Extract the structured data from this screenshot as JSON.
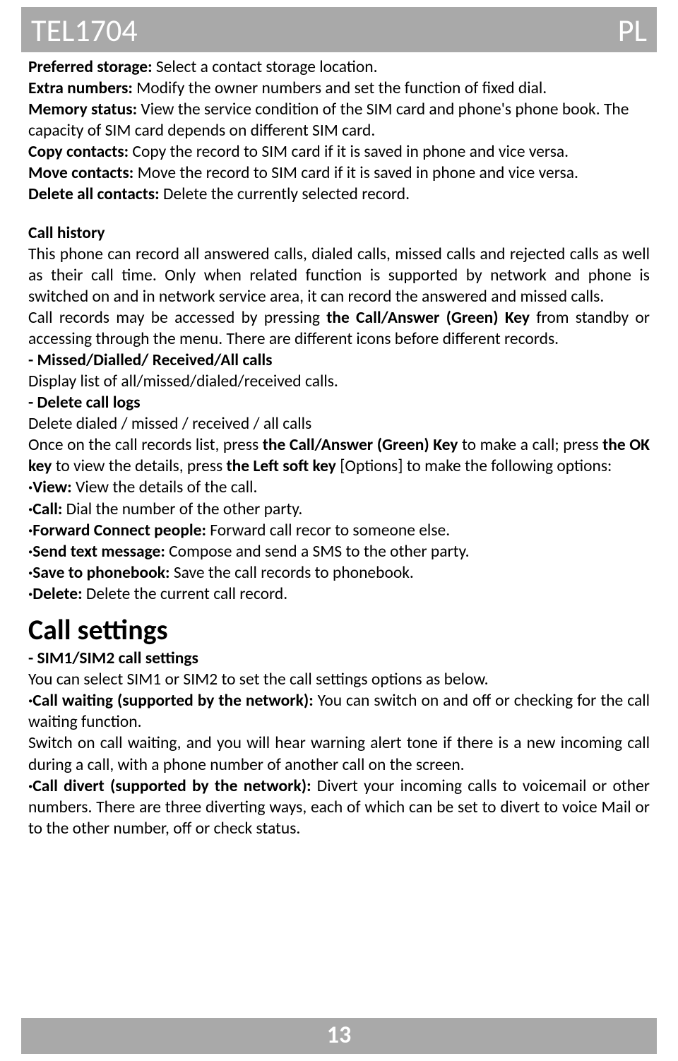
{
  "header": {
    "model": "TEL1704",
    "lang": "PL"
  },
  "footer": {
    "page_number": "13"
  },
  "contacts": {
    "preferred_storage_label": "Preferred storage:",
    "preferred_storage_text": " Select a contact storage location.",
    "extra_numbers_label": "Extra numbers:",
    "extra_numbers_text": " Modify the owner numbers and set the function of fixed dial.",
    "memory_status_label": "Memory status:",
    "memory_status_text": " View the service condition of the SIM card and phone's phone book. The capacity of SIM card depends on different SIM card.",
    "copy_contacts_label": "Copy contacts:",
    "copy_contacts_text": " Copy the record to SIM card if it is saved in phone and vice versa.",
    "move_contacts_label": "Move contacts:",
    "move_contacts_text": " Move the record to SIM card if it is saved in phone and vice versa.",
    "delete_all_label": "Delete all contacts:",
    "delete_all_text": " Delete the currently selected record."
  },
  "call_history": {
    "title": "Call history",
    "p1a": "This phone can record all answered calls, dialed calls, missed calls and rejected calls as well as their call time. Only when related function is supported by network and phone is switched on and in network service area, it can record the answered and missed calls.",
    "p2a": "Call records may be accessed by pressing ",
    "p2b": "the Call/Answer (Green) Key",
    "p2c": " from standby or accessing through the menu. There are different icons before different records.",
    "sec1_title": "- Missed/Dialled/ Received/All calls",
    "sec1_text": "Display list of all/missed/dialed/received calls.",
    "sec2_title": "- Delete call logs",
    "sec2_text": "Delete dialed / missed / received / all calls",
    "once_a": "Once on the call records list, press ",
    "once_b": "the Call/Answer (Green) Key",
    "once_c": " to make a call; press ",
    "once_d": "the OK key",
    "once_e": " to view the details, press ",
    "once_f": "the Left soft key",
    "once_g": " [Options] to make the following options:",
    "opt_view_label": "·View:",
    "opt_view_text": " View the details of the call.",
    "opt_call_label": "·Call:",
    "opt_call_text": " Dial the number of the other party.",
    "opt_fwd_label": "·Forward Connect people:",
    "opt_fwd_text": " Forward call recor to someone else.",
    "opt_sms_label": "·Send text message:",
    "opt_sms_text": " Compose and send a SMS to the other party.",
    "opt_save_label": "·Save to phonebook:",
    "opt_save_text": " Save the call records to phonebook.",
    "opt_del_label": "·Delete:",
    "opt_del_text": " Delete the current call record."
  },
  "call_settings": {
    "title": "Call settings",
    "sim_title": "- SIM1/SIM2 call settings",
    "sim_text": "You can select SIM1 or SIM2 to set the call settings options as below.",
    "cw_label": "·Call waiting (supported by the network):",
    "cw_text": " You can switch on and off or checking for the call waiting function.",
    "cw_note": "Switch on call waiting, and you will hear warning alert tone if there is a new incoming call during a call, with a phone number of another call on the screen.",
    "cd_label": "·Call divert (supported by the network):",
    "cd_text": " Divert your incoming calls to voicemail or other numbers. There are three diverting ways, each of which can be set to divert to voice Mail or to the other number, off or check status."
  }
}
